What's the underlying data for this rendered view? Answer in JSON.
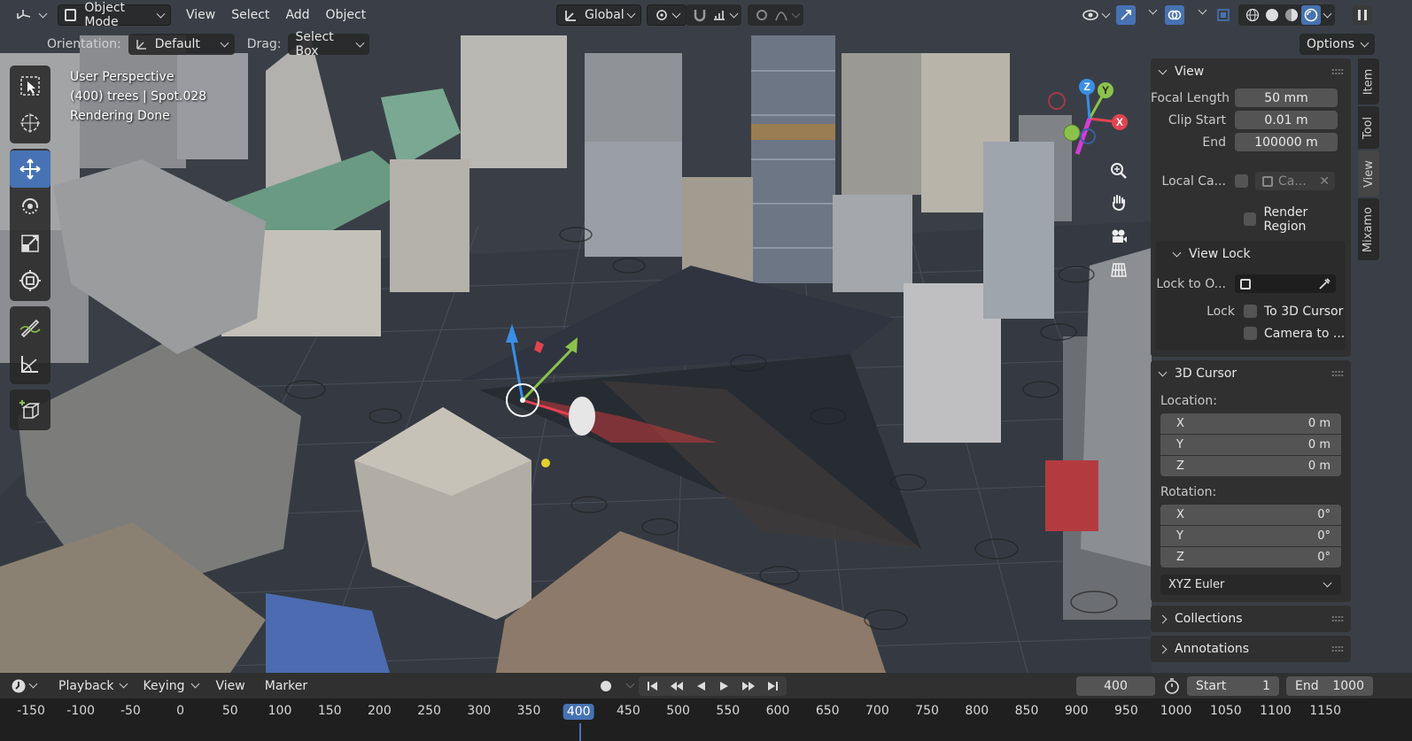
{
  "header": {
    "editor_type_icon": "view3d-icon",
    "mode": "Object Mode",
    "menus": [
      "View",
      "Select",
      "Add",
      "Object"
    ],
    "orientation_global": "Global"
  },
  "toolsettings": {
    "orientation_label": "Orientation:",
    "orientation_value": "Default",
    "drag_label": "Drag:",
    "drag_value": "Select Box",
    "options": "Options"
  },
  "overlay": {
    "line1": "User Perspective",
    "line2": "(400) trees | Spot.028",
    "line3": "Rendering Done"
  },
  "gizmo": {
    "x": "X",
    "y": "Y",
    "z": "Z"
  },
  "sidebar": {
    "view_panel": {
      "title": "View",
      "focal_length_label": "Focal Length",
      "focal_length": "50 mm",
      "clip_start_label": "Clip Start",
      "clip_start": "0.01 m",
      "end_label": "End",
      "end": "100000 m",
      "local_camera_label": "Local Ca...",
      "local_camera_value": "Ca...",
      "render_region": "Render Region",
      "view_lock_title": "View Lock",
      "lock_to_object_label": "Lock to O...",
      "lock_label": "Lock",
      "to_3d_cursor": "To 3D Cursor",
      "camera_to": "Camera to ..."
    },
    "cursor_panel": {
      "title": "3D Cursor",
      "location_label": "Location:",
      "location": [
        {
          "axis": "X",
          "value": "0 m"
        },
        {
          "axis": "Y",
          "value": "0 m"
        },
        {
          "axis": "Z",
          "value": "0 m"
        }
      ],
      "rotation_label": "Rotation:",
      "rotation": [
        {
          "axis": "X",
          "value": "0°"
        },
        {
          "axis": "Y",
          "value": "0°"
        },
        {
          "axis": "Z",
          "value": "0°"
        }
      ],
      "rotation_mode": "XYZ Euler"
    },
    "collections_title": "Collections",
    "annotations_title": "Annotations",
    "tabs": [
      "Item",
      "Tool",
      "View",
      "Mixamo"
    ]
  },
  "timeline": {
    "menus": [
      "Playback",
      "Keying",
      "View",
      "Marker"
    ],
    "current_frame": "400",
    "start_label": "Start",
    "start": "1",
    "end_label": "End",
    "end": "1000",
    "ticks": [
      "-150",
      "-100",
      "-50",
      "0",
      "50",
      "100",
      "150",
      "200",
      "250",
      "300",
      "350",
      "400",
      "450",
      "500",
      "550",
      "600",
      "650",
      "700",
      "750",
      "800",
      "850",
      "900",
      "950",
      "1000",
      "1050",
      "1100",
      "1150"
    ]
  },
  "colors": {
    "accent": "#4772b3",
    "panel_bg": "#303030",
    "field_bg": "#545454",
    "axis_x": "#e34350",
    "axis_y": "#8bc34a",
    "axis_z": "#3a8ee6"
  }
}
